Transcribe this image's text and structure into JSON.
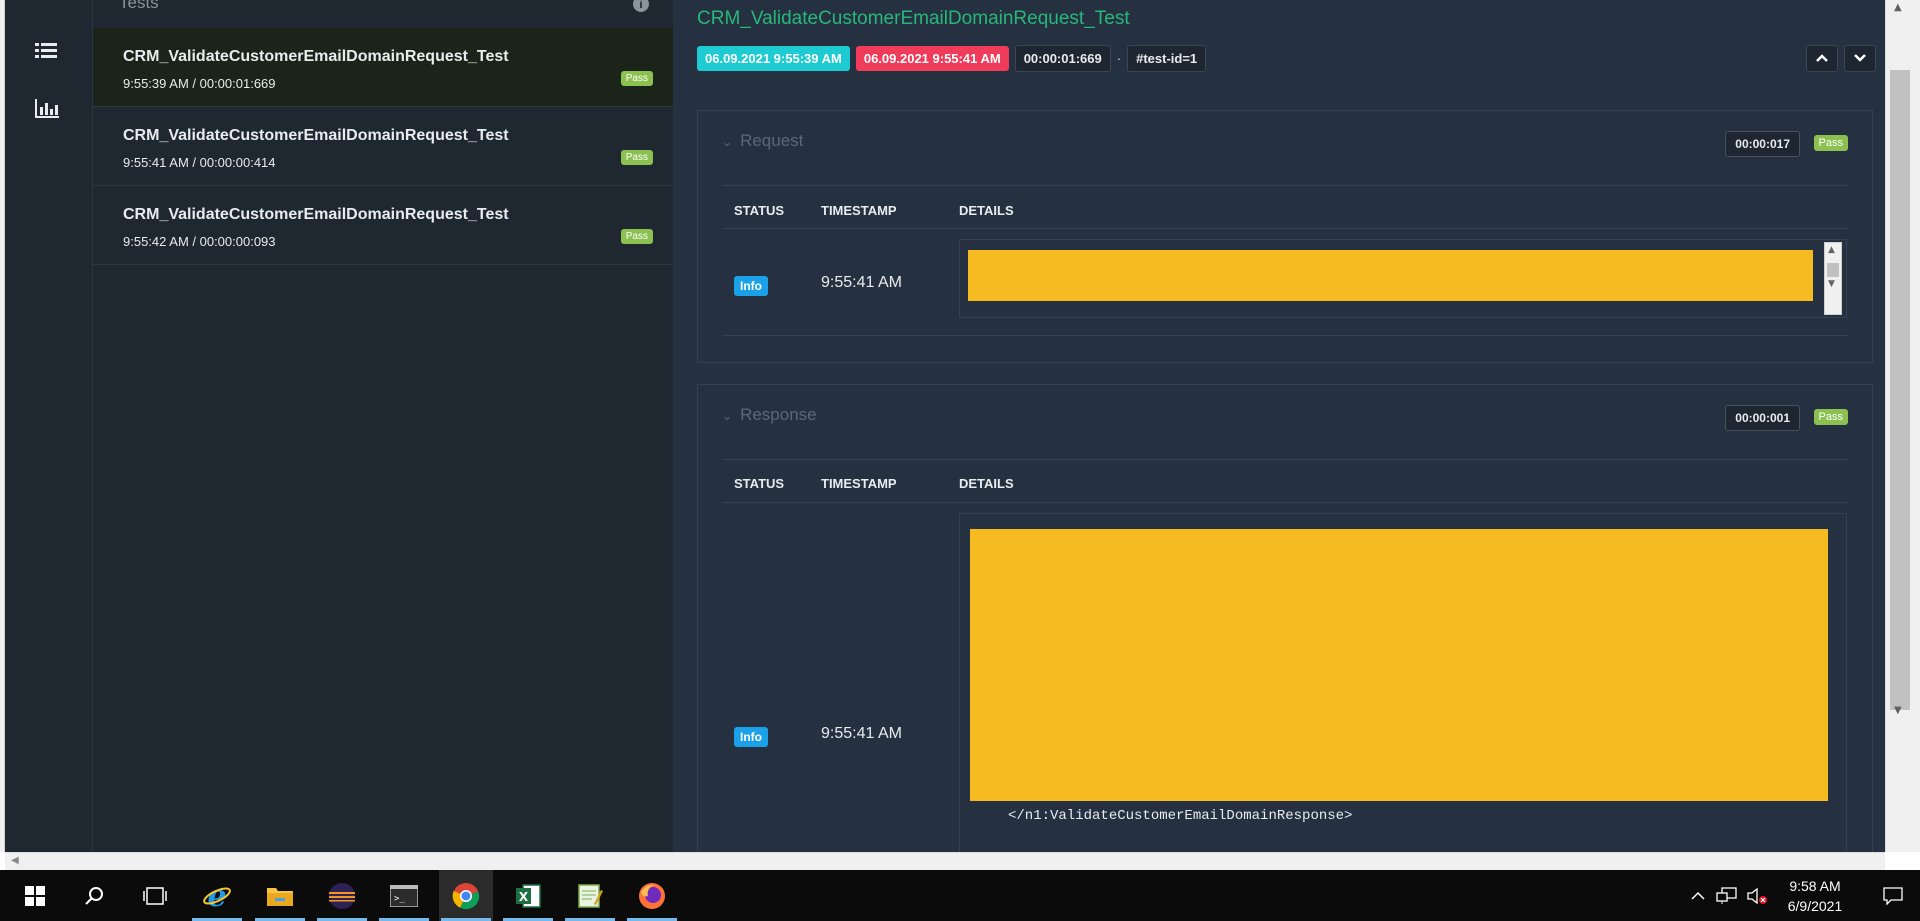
{
  "sidebar": {
    "header": "Tests",
    "items": [
      {
        "name": "CRM_ValidateCustomerEmailDomainRequest_Test",
        "meta": "9:55:39 AM / 00:00:01:669",
        "status": "Pass"
      },
      {
        "name": "CRM_ValidateCustomerEmailDomainRequest_Test",
        "meta": "9:55:41 AM / 00:00:00:414",
        "status": "Pass"
      },
      {
        "name": "CRM_ValidateCustomerEmailDomainRequest_Test",
        "meta": "9:55:42 AM / 00:00:00:093",
        "status": "Pass"
      }
    ]
  },
  "main": {
    "title": "CRM_ValidateCustomerEmailDomainRequest_Test",
    "start_time": "06.09.2021 9:55:39 AM",
    "end_time": "06.09.2021 9:55:41 AM",
    "duration": "00:00:01:669",
    "separator": "·",
    "test_id": "#test-id=1",
    "nodes": [
      {
        "name": "Request",
        "duration": "00:00:017",
        "status": "Pass",
        "headers": {
          "status": "STATUS",
          "timestamp": "TIMESTAMP",
          "details": "DETAILS"
        },
        "log": {
          "status": "Info",
          "timestamp": "9:55:41 AM"
        }
      },
      {
        "name": "Response",
        "duration": "00:00:001",
        "status": "Pass",
        "headers": {
          "status": "STATUS",
          "timestamp": "TIMESTAMP",
          "details": "DETAILS"
        },
        "log": {
          "status": "Info",
          "timestamp": "9:55:41 AM",
          "details_tail": "</n1:ValidateCustomerEmailDomainResponse>"
        }
      }
    ]
  },
  "colors": {
    "pass": "#8cc152",
    "info": "#1ba1e8",
    "start_chip": "#1ecbd3",
    "end_chip": "#f03b5a",
    "title": "#28b779",
    "redaction": "#f5bb21"
  },
  "taskbar": {
    "items": [
      "windows-start-icon",
      "search-icon",
      "task-view-icon",
      "internet-explorer-icon",
      "file-explorer-icon",
      "eclipse-icon",
      "command-prompt-icon",
      "chrome-icon",
      "excel-icon",
      "notepad-icon",
      "firefox-icon"
    ],
    "clock_time": "9:58 AM",
    "clock_date": "6/9/2021"
  }
}
